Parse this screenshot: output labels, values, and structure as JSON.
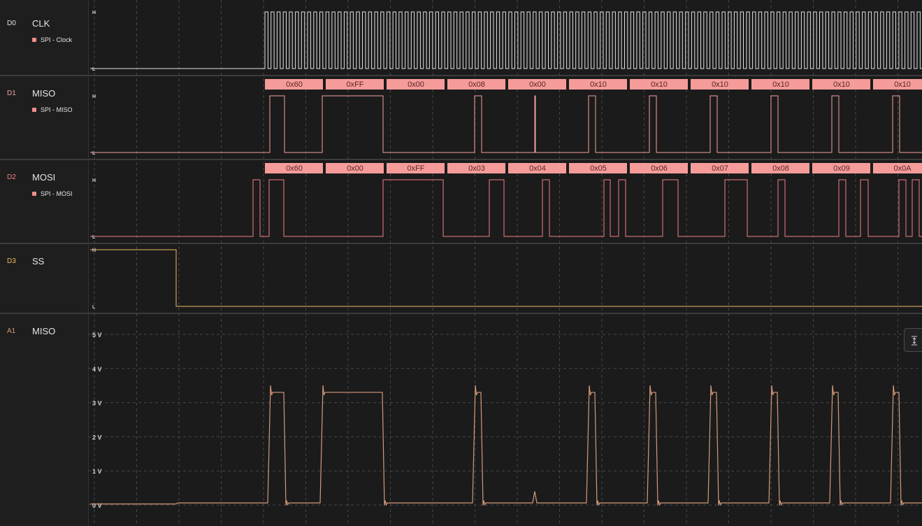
{
  "colors": {
    "clk": "#e2e2e2",
    "miso": "#f4a29e",
    "mosi": "#f07f86",
    "ss": "#f2b864",
    "analog": "#d49a7a",
    "frame": "#f59c9a",
    "frame_text": "#5a2424",
    "grid": "#474747"
  },
  "channels": [
    {
      "id": "D0",
      "name": "CLK",
      "analyzer": "SPI - Clock",
      "id_color": "#e2e2e2"
    },
    {
      "id": "D1",
      "name": "MISO",
      "analyzer": "SPI - MISO",
      "id_color": "#f4a29e"
    },
    {
      "id": "D2",
      "name": "MOSI",
      "analyzer": "SPI - MOSI",
      "id_color": "#f07f86"
    },
    {
      "id": "D3",
      "name": "SS",
      "analyzer": "",
      "id_color": "#f2b864"
    },
    {
      "id": "A1",
      "name": "MISO",
      "analyzer": "",
      "id_color": "#d49a7a"
    }
  ],
  "level_labels": {
    "high": "H",
    "low": "L"
  },
  "miso_bytes": [
    "0x60",
    "0xFF",
    "0x00",
    "0x08",
    "0x00",
    "0x10",
    "0x10",
    "0x10",
    "0x10",
    "0x10",
    "0x10"
  ],
  "mosi_bytes": [
    "0x60",
    "0x00",
    "0xFF",
    "0x03",
    "0x04",
    "0x05",
    "0x06",
    "0x07",
    "0x08",
    "0x09",
    "0x0A"
  ],
  "analog_axis": [
    "0 V",
    "1 V",
    "2 V",
    "3 V",
    "4 V",
    "5 V"
  ],
  "icons": {
    "expand_button": "expand-vertical-icon"
  }
}
